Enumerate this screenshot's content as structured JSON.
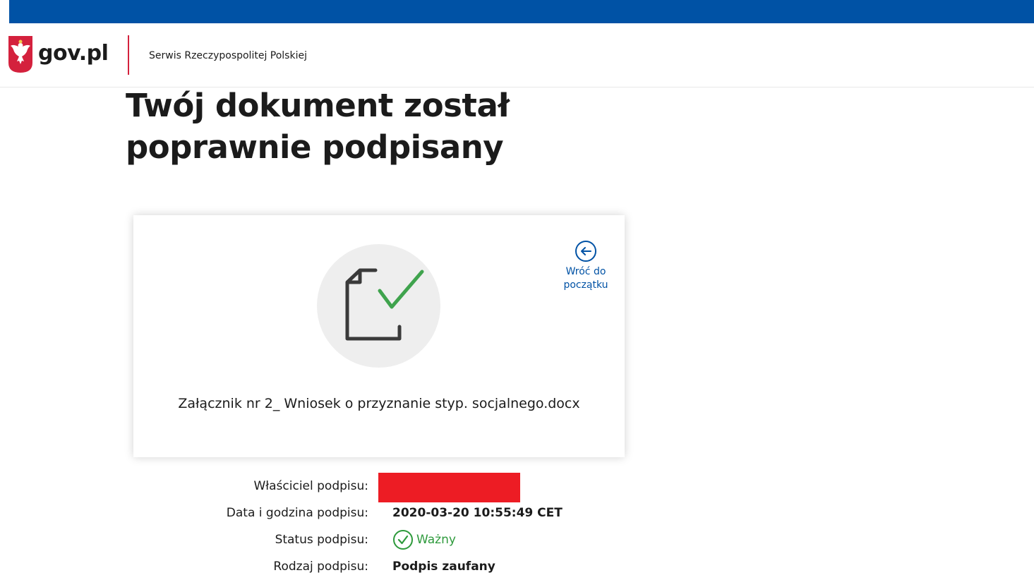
{
  "header": {
    "logo_text": "gov.pl",
    "service_name": "Serwis Rzeczypospolitej Polskiej"
  },
  "page": {
    "title": "Twój dokument został poprawnie podpisany"
  },
  "card": {
    "back_link_label": "Wróć do\npoczątku",
    "file_name": "Załącznik nr 2_ Wniosek o przyznanie styp. socjalnego.docx"
  },
  "signature": {
    "owner_label": "Właściciel podpisu:",
    "owner_value": "",
    "datetime_label": "Data i godzina podpisu:",
    "datetime_value": "2020-03-20 10:55:49 CET",
    "status_label": "Status podpisu:",
    "status_value": "Ważny",
    "type_label": "Rodzaj podpisu:",
    "type_value": "Podpis zaufany"
  },
  "colors": {
    "brand_blue": "#0052a5",
    "divider_red": "#d4213d",
    "valid_green": "#2e9a3c",
    "redaction_red": "#ed1c24"
  },
  "icons": {
    "emblem": "polish-eagle-emblem",
    "document": "document-check-icon",
    "back": "arrow-left-circle-icon",
    "status": "check-circle-icon"
  }
}
